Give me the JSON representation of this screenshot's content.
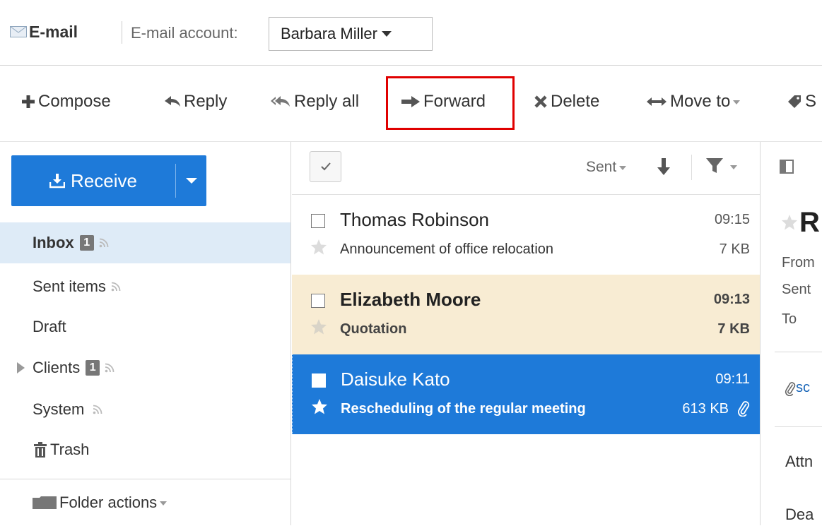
{
  "header": {
    "app_title": "E-mail",
    "account_label": "E-mail account:",
    "account_value": "Barbara Miller"
  },
  "toolbar": {
    "compose": "Compose",
    "reply": "Reply",
    "reply_all": "Reply all",
    "forward": "Forward",
    "delete": "Delete",
    "move_to": "Move to",
    "label_partial": "S"
  },
  "sidebar": {
    "receive": "Receive",
    "folders": [
      {
        "name": "Inbox",
        "badge": "1"
      },
      {
        "name": "Sent items"
      },
      {
        "name": "Draft"
      },
      {
        "name": "Clients",
        "badge": "1"
      },
      {
        "name": "System"
      },
      {
        "name": "Trash"
      }
    ],
    "folder_actions": "Folder actions"
  },
  "list": {
    "sort_label": "Sent",
    "messages": [
      {
        "sender": "Thomas Robinson",
        "time": "09:15",
        "subject": "Announcement of office relocation",
        "size": "7 KB"
      },
      {
        "sender": "Elizabeth Moore",
        "time": "09:13",
        "subject": "Quotation",
        "size": "7 KB"
      },
      {
        "sender": "Daisuke Kato",
        "time": "09:11",
        "subject": "Rescheduling of the regular meeting",
        "size": "613 KB"
      }
    ]
  },
  "preview": {
    "title_partial": "R",
    "from_partial": "From",
    "sent_partial": "Sent",
    "to_label": "To",
    "attachment_partial": "sc",
    "body_line1_partial": "Attn",
    "body_line2_partial": "Dea"
  },
  "colors": {
    "accent": "#1e7ad9",
    "selected_folder_bg": "#deebf7",
    "unread_row_bg": "#f8ecd3",
    "highlight_box": "#e00000"
  }
}
